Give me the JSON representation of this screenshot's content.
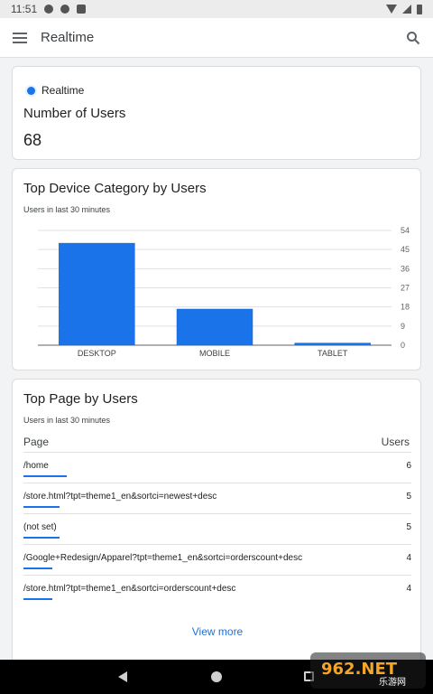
{
  "status_bar": {
    "time": "11:51"
  },
  "app_bar": {
    "title": "Realtime"
  },
  "realtime_card": {
    "indicator_label": "Realtime",
    "metric_label": "Number of Users",
    "metric_value": "68"
  },
  "device_card": {
    "title": "Top Device Category by Users",
    "subtitle": "Users in last 30 minutes"
  },
  "chart_data": {
    "type": "bar",
    "categories": [
      "DESKTOP",
      "MOBILE",
      "TABLET"
    ],
    "values": [
      48,
      17,
      1
    ],
    "title": "Top Device Category by Users",
    "subtitle": "Users in last 30 minutes",
    "xlabel": "",
    "ylabel": "",
    "ylim": [
      0,
      54
    ],
    "yticks": [
      "54",
      "45",
      "36",
      "27",
      "18",
      "9",
      "0"
    ],
    "y_axis_side": "right",
    "grid": true,
    "color": "#1a73e8"
  },
  "pages_card": {
    "title": "Top Page by Users",
    "subtitle": "Users in last 30 minutes",
    "col_page": "Page",
    "col_users": "Users",
    "rows": [
      {
        "page": "/home",
        "users": "6",
        "share": 1.0
      },
      {
        "page": "/store.html?tpt=theme1_en&sortci=newest+desc",
        "users": "5",
        "share": 0.83
      },
      {
        "page": "(not set)",
        "users": "5",
        "share": 0.83
      },
      {
        "page": "/Google+Redesign/Apparel?tpt=theme1_en&sortci=orderscount+desc",
        "users": "4",
        "share": 0.67
      },
      {
        "page": "/store.html?tpt=theme1_en&sortci=orderscount+desc",
        "users": "4",
        "share": 0.67
      }
    ],
    "view_more": "View more"
  },
  "watermark": {
    "brand": "962.NET",
    "sub": "乐游网"
  },
  "colors": {
    "accent": "#1a73e8",
    "background": "#f1f3f4"
  }
}
